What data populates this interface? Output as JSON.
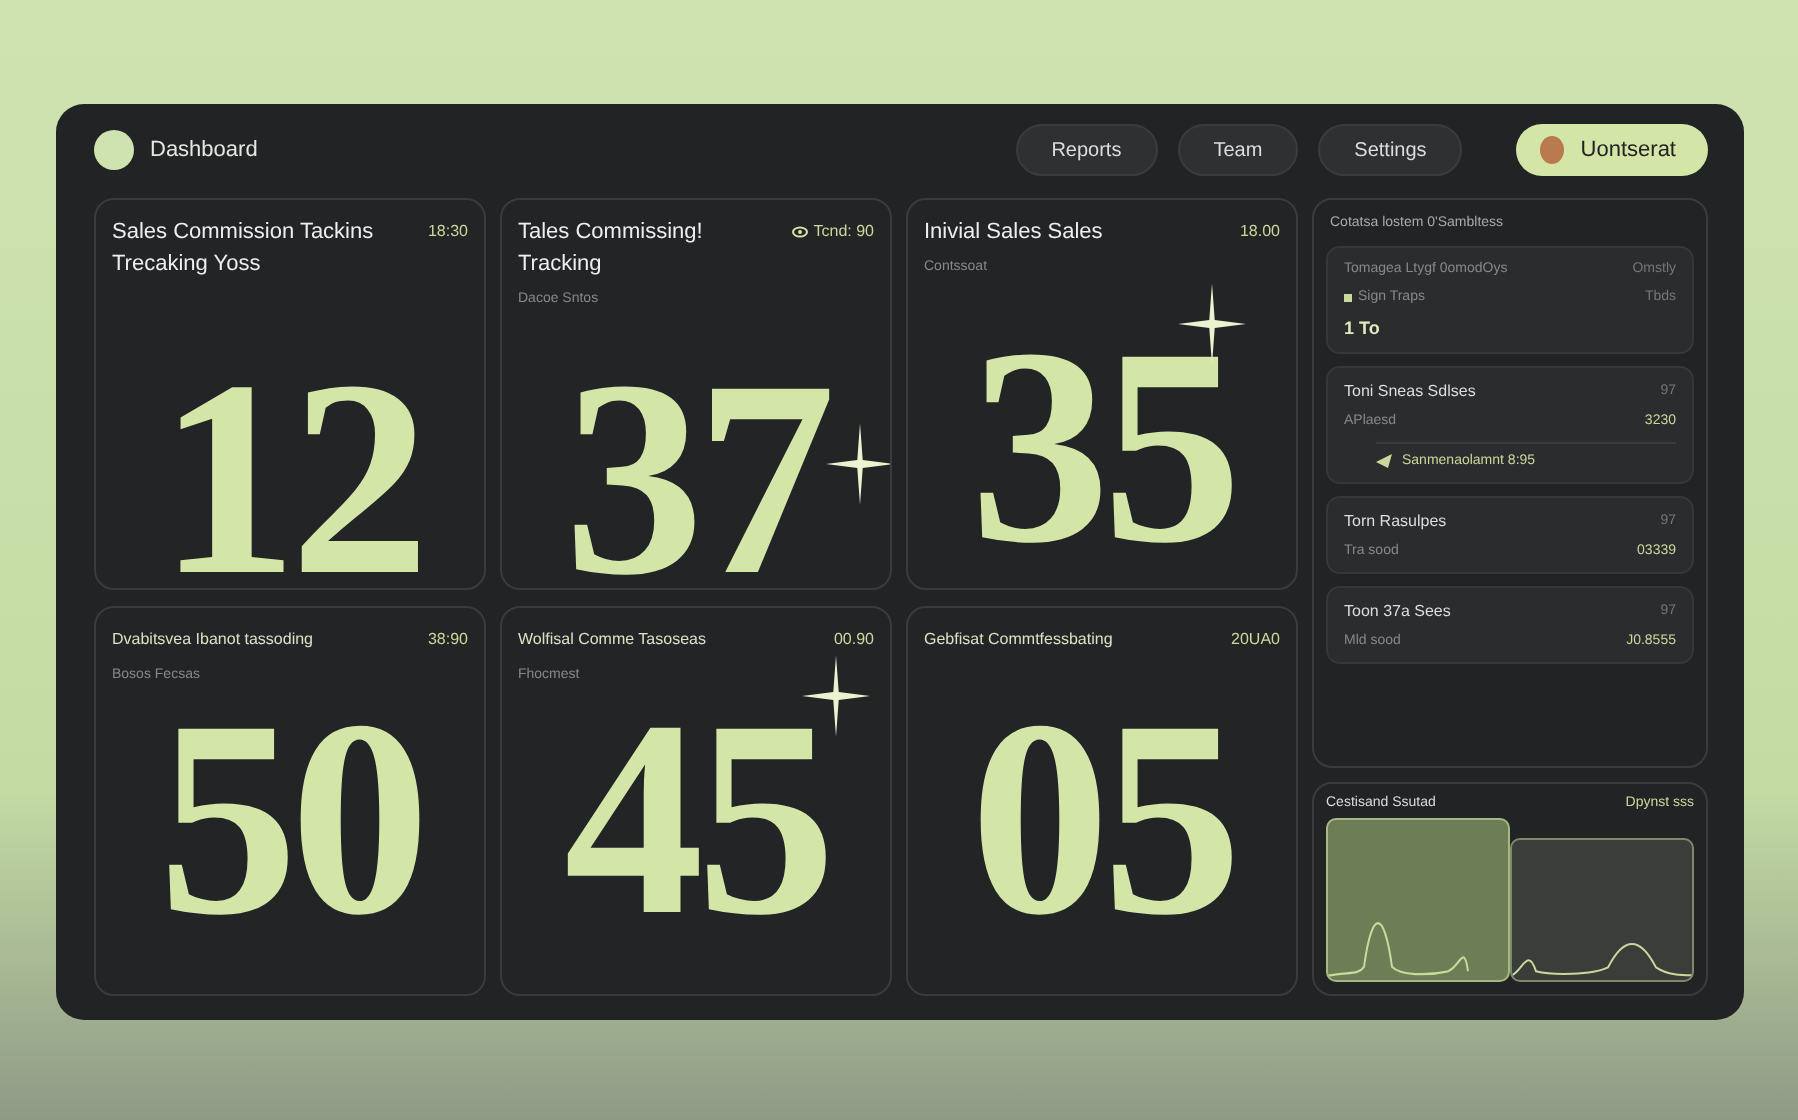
{
  "header": {
    "title": "Dashboard",
    "nav": [
      {
        "label": "Reports",
        "selected": false
      },
      {
        "label": "Team",
        "selected": false
      },
      {
        "label": "Settings",
        "selected": false
      }
    ],
    "user": {
      "name": "Uontserat"
    }
  },
  "cards": [
    {
      "title": "Sales Commission  Tackins Trecaking Yoss",
      "value": "18:30",
      "number": "12",
      "sparkle": false,
      "icon": false
    },
    {
      "title": "Tales Commissing! Tracking",
      "value": "Tcnd: 90",
      "subtitle": "Dacoe Sntos",
      "number": "37",
      "sparkle": true,
      "icon": true
    },
    {
      "title": "Inivial Sales  Sales",
      "value": "18.00",
      "subtitle": "Contssoat",
      "number": "35",
      "sparkle": true,
      "icon": false
    },
    {
      "title": "Dvabitsvea Ibanot tassoding",
      "value": "38:90",
      "subtitle": "Bosos Fecsas",
      "number": "50",
      "sparkle": false,
      "icon": false
    },
    {
      "title": "Wolfisal Comme Tasoseas",
      "value": "00.90",
      "subtitle": "Fhocmest",
      "number": "45",
      "sparkle": true,
      "icon": false
    },
    {
      "title": "Gebfisat Commtfessbating",
      "value": "20UA0",
      "number": "05",
      "sparkle": false,
      "icon": false
    }
  ],
  "side": {
    "title": "Cotatsa lostem 0'Sambltess",
    "items": [
      {
        "title": "Tomagea Ltygf 0omodOys",
        "corner": "Omstly",
        "rows": [
          {
            "label": "Sign Traps",
            "value": "Tbds"
          }
        ],
        "note": {
          "kind": "plain",
          "text": "1 To"
        }
      },
      {
        "title": "Toni Sneas Sdlses",
        "corner": "97",
        "rows": [
          {
            "label": "APlaesd",
            "value": "3230"
          }
        ],
        "note": {
          "kind": "arrow",
          "text": "Sanmenaolamnt 8:95"
        }
      },
      {
        "title": "Torn Rasulpes",
        "corner": "97",
        "rows": [
          {
            "label": "Tra sood",
            "value": "03339"
          }
        ]
      },
      {
        "title": "Toon 37a Sees",
        "corner": "97",
        "rows": [
          {
            "label": "Mld sood",
            "value": "J0.8555"
          }
        ]
      }
    ]
  },
  "chart": {
    "title": "Cestisand Ssutad",
    "link": "Dpynst sss",
    "panels": [
      {
        "selected": true
      },
      {
        "selected": false
      }
    ]
  }
}
